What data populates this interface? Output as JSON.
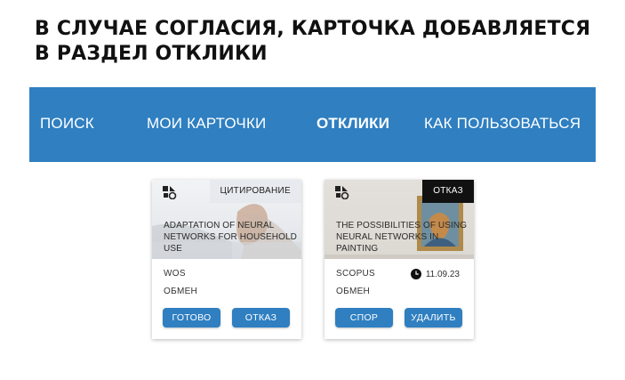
{
  "heading": {
    "line1": "В СЛУЧАЕ СОГЛАСИЯ, КАРТОЧКА ДОБАВЛЯЕТСЯ",
    "line2": "В РАЗДЕЛ ОТКЛИКИ"
  },
  "nav": {
    "items": [
      {
        "label": "ПОИСК",
        "active": false
      },
      {
        "label": "МОИ КАРТОЧКИ",
        "active": false
      },
      {
        "label": "ОТКЛИКИ",
        "active": true
      },
      {
        "label": "КАК ПОЛЬЗОВАТЬСЯ",
        "active": false
      }
    ],
    "background": "#2f7fc1"
  },
  "cards": [
    {
      "tag": "ЦИТИРОВАНИЕ",
      "title": "ADAPTATION OF NEURAL NETWORKS FOR HOUSEHOLD USE",
      "database": "WOS",
      "type": "ОБМЕН",
      "buttons": [
        "ГОТОВО",
        "ОТКАЗ"
      ]
    },
    {
      "tag": "ОТКАЗ",
      "title": "THE POSSIBILITIES OF USING NEURAL NETWORKS IN PAINTING",
      "database": "SCOPUS",
      "date": "11.09.23",
      "type": "ОБМЕН",
      "buttons": [
        "СПОР",
        "УДАЛИТЬ"
      ]
    }
  ],
  "icons": {
    "card_logo": "shapes-logo-icon",
    "date": "clock-icon"
  },
  "colors": {
    "accent": "#2f7fc1",
    "rejected_tag": "#111111"
  }
}
